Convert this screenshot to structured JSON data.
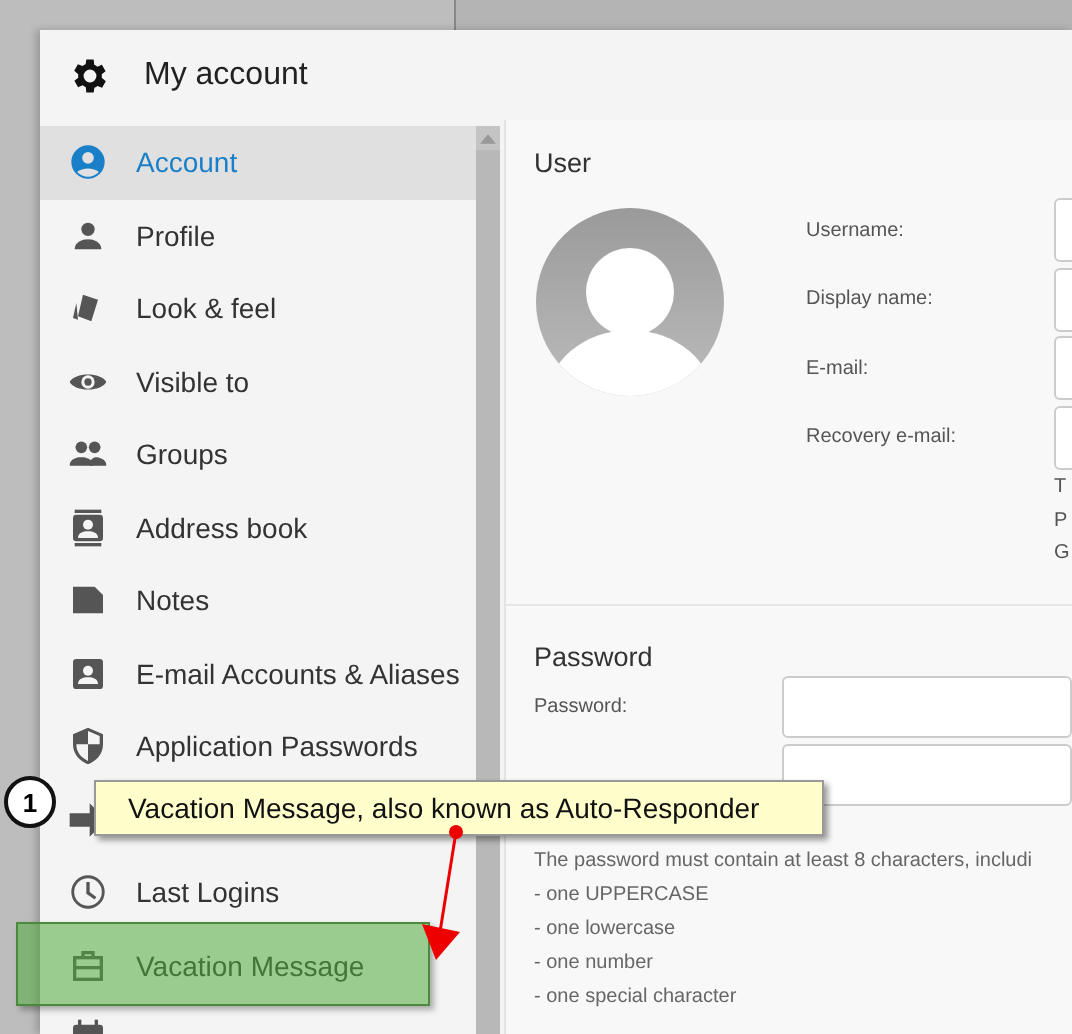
{
  "window": {
    "title": "My account"
  },
  "sidebar": {
    "items": [
      {
        "label": "Account",
        "kind": "account",
        "selected": true
      },
      {
        "label": "Profile",
        "kind": "person",
        "selected": false
      },
      {
        "label": "Look & feel",
        "kind": "cards",
        "selected": false
      },
      {
        "label": "Visible to",
        "kind": "eye",
        "selected": false
      },
      {
        "label": "Groups",
        "kind": "people",
        "selected": false
      },
      {
        "label": "Address book",
        "kind": "contacts",
        "selected": false
      },
      {
        "label": "Notes",
        "kind": "note",
        "selected": false
      },
      {
        "label": "E-mail Accounts & Aliases",
        "kind": "badge",
        "selected": false
      },
      {
        "label": "Application Passwords",
        "kind": "shield",
        "selected": false
      },
      {
        "kind": "arrow",
        "selected": false
      },
      {
        "label": "Last Logins",
        "kind": "clock",
        "selected": false
      },
      {
        "label": "Vacation Message",
        "kind": "briefcase",
        "selected": false
      },
      {
        "kind": "calendar",
        "selected": false
      }
    ]
  },
  "user": {
    "heading": "User",
    "fields": [
      {
        "label": "Username:"
      },
      {
        "label": "Display name:"
      },
      {
        "label": "E-mail:"
      },
      {
        "label": "Recovery e-mail:"
      }
    ],
    "help_lines": [
      "T",
      "P",
      "G"
    ]
  },
  "password": {
    "heading": "Password",
    "fields": [
      {
        "label": "Password:",
        "kind": "text-input"
      },
      {
        "kind": "text-input"
      }
    ],
    "rules": [
      "The password must contain at least 8 characters, includi",
      "- one UPPERCASE",
      "- one lowercase",
      "- one number",
      "- one special character"
    ]
  },
  "annotation": {
    "number": "1",
    "text": "Vacation Message, also known as Auto-Responder"
  }
}
